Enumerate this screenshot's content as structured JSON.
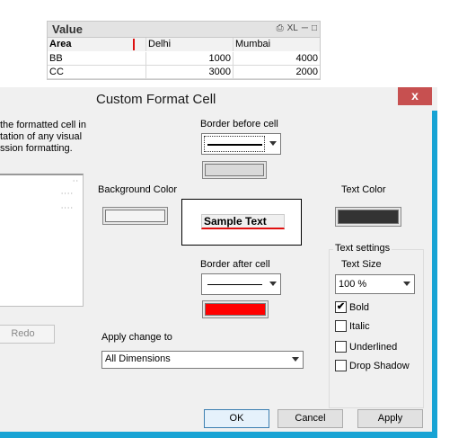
{
  "table": {
    "title": "Value",
    "toolbar_xl": "XL",
    "header": [
      "Area",
      "Delhi",
      "Mumbai"
    ],
    "rows": [
      [
        "BB",
        "1000",
        "4000"
      ],
      [
        "CC",
        "3000",
        "2000"
      ]
    ]
  },
  "dialog": {
    "title": "Custom Format Cell",
    "close_glyph": "x",
    "description_lines": [
      "the formatted cell in",
      "tation of any visual",
      "ssion formatting."
    ],
    "redo_label": "Redo",
    "border_before_label": "Border before cell",
    "background_color_label": "Background Color",
    "sample_text": "Sample Text",
    "text_color_label": "Text Color",
    "border_after_label": "Border after cell",
    "apply_change_label": "Apply change to",
    "apply_change_value": "All Dimensions",
    "text_settings_label": "Text settings",
    "text_size_label": "Text Size",
    "text_size_value": "100 %",
    "checkboxes": {
      "bold": {
        "label": "Bold",
        "checked": true
      },
      "italic": {
        "label": "Italic",
        "checked": false
      },
      "underlined": {
        "label": "Underlined",
        "checked": false
      },
      "drop_shadow": {
        "label": "Drop Shadow",
        "checked": false
      }
    },
    "ok_label": "OK",
    "cancel_label": "Cancel",
    "apply_label": "Apply",
    "check_glyph": "✔"
  },
  "colors": {
    "title_accent": "#17a3d4",
    "close_red": "#c75050",
    "border_before_color": "#d9d9d9",
    "background_color": "#f4f4f4",
    "text_color": "#333333",
    "border_after_color": "#ff0000"
  }
}
